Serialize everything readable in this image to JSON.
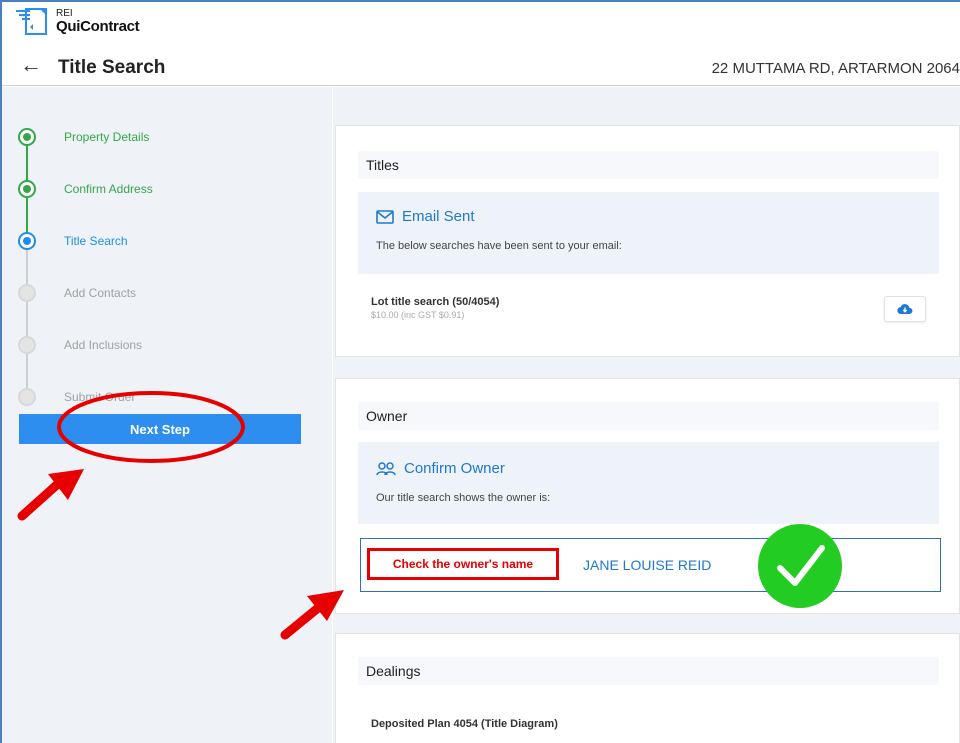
{
  "app": {
    "logo_small": "REI",
    "logo_big": "QuiContract"
  },
  "header": {
    "title": "Title Search",
    "address": "22 MUTTAMA RD, ARTARMON 2064"
  },
  "sidebar": {
    "steps": [
      {
        "label": "Property Details",
        "state": "done"
      },
      {
        "label": "Confirm Address",
        "state": "done"
      },
      {
        "label": "Title Search",
        "state": "active"
      },
      {
        "label": "Add Contacts",
        "state": "todo"
      },
      {
        "label": "Add Inclusions",
        "state": "todo"
      },
      {
        "label": "Submit Order",
        "state": "todo"
      }
    ],
    "next_label": "Next Step"
  },
  "titles": {
    "heading": "Titles",
    "notice_title": "Email Sent",
    "notice_sub": "The below searches have been sent to your email:",
    "item_title": "Lot title search (50/4054)",
    "item_sub": "$10.00 (inc GST $0.91)"
  },
  "owner": {
    "heading": "Owner",
    "notice_title": "Confirm Owner",
    "notice_sub": "Our title search shows the owner is:",
    "check_label": "Check the owner's name",
    "owner_name": "JANE LOUISE REID"
  },
  "dealings": {
    "heading": "Dealings",
    "item_title": "Deposited Plan 4054 (Title Diagram)"
  },
  "colors": {
    "accent": "#2e8ef0",
    "done": "#36a64a",
    "annotation_red": "#e60000",
    "check_green": "#22cc22"
  }
}
